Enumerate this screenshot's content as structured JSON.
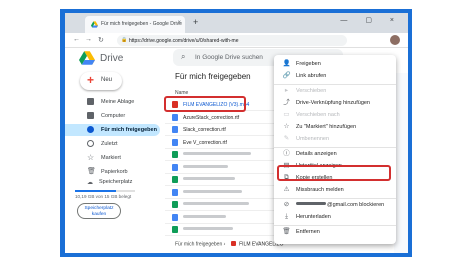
{
  "browser": {
    "tab_title": "Für mich freigegeben - Google Drive",
    "tab_close": "×",
    "new_tab": "+",
    "window_buttons": "— ▢ ×",
    "url": "https://drive.google.com/drive/u/0/shared-with-me",
    "back": "←",
    "forward": "→",
    "reload": "↻"
  },
  "drive": {
    "logo_text": "Drive",
    "search_placeholder": "In Google Drive suchen",
    "new_button": "Neu",
    "nav": [
      {
        "label": "Meine Ablage",
        "color": "#5f6368"
      },
      {
        "label": "Computer",
        "color": "#5f6368"
      },
      {
        "label": "Für mich freigegeben",
        "color": "#0b57d0"
      },
      {
        "label": "Zuletzt",
        "color": "#5f6368"
      },
      {
        "label": "Markiert",
        "color": "#5f6368"
      },
      {
        "label": "Papierkorb",
        "color": "#5f6368"
      }
    ],
    "storage_label": "Speicherplatz",
    "storage_text": "10,19 GB von 15 GB belegt",
    "storage_fraction": 0.68,
    "storage_button": "Speicherplatz kaufen",
    "main_title": "Für mich freigegeben",
    "column_header": "Name",
    "files": [
      {
        "name": "FILM EVANGELIZO (V3).mp4",
        "color": "#d93025",
        "highlight": true
      },
      {
        "name": "AzureStack_correction.rtf",
        "color": "#4285f4"
      },
      {
        "name": "Slack_correction.rtf",
        "color": "#4285f4"
      },
      {
        "name": "Eve V_correction.rtf",
        "color": "#4285f4"
      },
      {
        "name": "",
        "color": "#0f9d58"
      },
      {
        "name": "",
        "color": "#4285f4"
      },
      {
        "name": "",
        "color": "#0f9d58"
      },
      {
        "name": "",
        "color": "#4285f4"
      },
      {
        "name": "",
        "color": "#0f9d58"
      },
      {
        "name": "",
        "color": "#4285f4"
      },
      {
        "name": "",
        "color": "#0f9d58"
      }
    ],
    "breadcrumb_parent": "Für mich freigegeben  ›",
    "breadcrumb_file": "FILM EVANGELIZO"
  },
  "menu": {
    "items": [
      {
        "label": "Freigeben",
        "icon": "person-add-icon",
        "glyph": "👤",
        "disabled": false
      },
      {
        "label": "Link abrufen",
        "icon": "link-icon",
        "glyph": "🔗",
        "disabled": false
      },
      {
        "label": "Verschieben",
        "icon": "folder-move-icon",
        "glyph": "▸",
        "disabled": true
      },
      {
        "label": "Drive-Verknüpfung hinzufügen",
        "icon": "shortcut-icon",
        "glyph": "⤴",
        "disabled": false
      },
      {
        "label": "Verschieben nach",
        "icon": "folder-icon",
        "glyph": "▭",
        "disabled": true
      },
      {
        "label": "Zu \"Markiert\" hinzufügen",
        "icon": "star-icon",
        "glyph": "☆",
        "disabled": false
      },
      {
        "label": "Umbenennen",
        "icon": "edit-icon",
        "glyph": "✎",
        "disabled": true
      },
      {
        "label": "Details anzeigen",
        "icon": "info-icon",
        "glyph": "ⓘ",
        "disabled": false
      },
      {
        "label": "Untertitel anzeigen",
        "icon": "subtitles-icon",
        "glyph": "▤",
        "disabled": false
      },
      {
        "label": "Kopie erstellen",
        "icon": "copy-icon",
        "glyph": "⧉",
        "disabled": false
      },
      {
        "label": "Missbrauch melden",
        "icon": "report-icon",
        "glyph": "⚠",
        "disabled": false
      },
      {
        "label": "@gmail.com blockieren",
        "icon": "block-icon",
        "glyph": "⊘",
        "disabled": false,
        "highlight": true
      },
      {
        "label": "Herunterladen",
        "icon": "download-icon",
        "glyph": "⤓",
        "disabled": false
      },
      {
        "label": "Entfernen",
        "icon": "trash-icon",
        "glyph": "🗑",
        "disabled": false
      }
    ]
  },
  "colors": {
    "frame_blue": "#1a6fd6",
    "highlight_red": "#d32f2f",
    "active_nav": "#c2e7ff"
  }
}
